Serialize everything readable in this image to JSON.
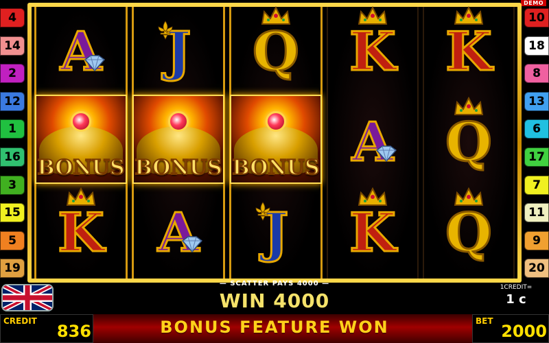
{
  "lines_left": [
    {
      "label": "4",
      "bg": "#e02020",
      "fg": "#000"
    },
    {
      "label": "14",
      "bg": "#f09090",
      "fg": "#000"
    },
    {
      "label": "2",
      "bg": "#c020c0",
      "fg": "#000"
    },
    {
      "label": "12",
      "bg": "#3a7ae0",
      "fg": "#000"
    },
    {
      "label": "1",
      "bg": "#20c040",
      "fg": "#000"
    },
    {
      "label": "16",
      "bg": "#30c070",
      "fg": "#000"
    },
    {
      "label": "3",
      "bg": "#40b020",
      "fg": "#000"
    },
    {
      "label": "15",
      "bg": "#f0f020",
      "fg": "#000"
    },
    {
      "label": "5",
      "bg": "#f08020",
      "fg": "#000"
    },
    {
      "label": "19",
      "bg": "#e0a040",
      "fg": "#000"
    }
  ],
  "lines_right": [
    {
      "label": "10",
      "bg": "#e02020",
      "fg": "#000"
    },
    {
      "label": "18",
      "bg": "#ffffff",
      "fg": "#000"
    },
    {
      "label": "8",
      "bg": "#f060a0",
      "fg": "#000"
    },
    {
      "label": "13",
      "bg": "#40a0f0",
      "fg": "#000"
    },
    {
      "label": "6",
      "bg": "#20c0e0",
      "fg": "#000"
    },
    {
      "label": "17",
      "bg": "#40d040",
      "fg": "#000"
    },
    {
      "label": "7",
      "bg": "#f0f020",
      "fg": "#000"
    },
    {
      "label": "11",
      "bg": "#f0f0c0",
      "fg": "#000"
    },
    {
      "label": "9",
      "bg": "#f0a030",
      "fg": "#000"
    },
    {
      "label": "20",
      "bg": "#f0c080",
      "fg": "#000"
    }
  ],
  "demo_label": "DEMO",
  "reels": [
    [
      "A",
      "BONUS",
      "K"
    ],
    [
      "J",
      "BONUS",
      "A"
    ],
    [
      "Q",
      "BONUS",
      "J"
    ],
    [
      "K",
      "A",
      "K"
    ],
    [
      "K",
      "Q",
      "Q"
    ]
  ],
  "bonus_text": "BONUS",
  "scatter_text": "SCATTER PAYS 4000",
  "win_text": "WIN 4000",
  "credit_value_label": "1CREDIT=",
  "credit_value": "1 c",
  "feature_text": "BONUS FEATURE WON",
  "credit_label": "CREDIT",
  "credit_amount": "836",
  "bet_label": "BET",
  "bet_amount": "2000",
  "colors": {
    "frame_gold": "#ffd84a",
    "win_yellow": "#f5e26a",
    "feature_yellow": "#ffd21a"
  }
}
